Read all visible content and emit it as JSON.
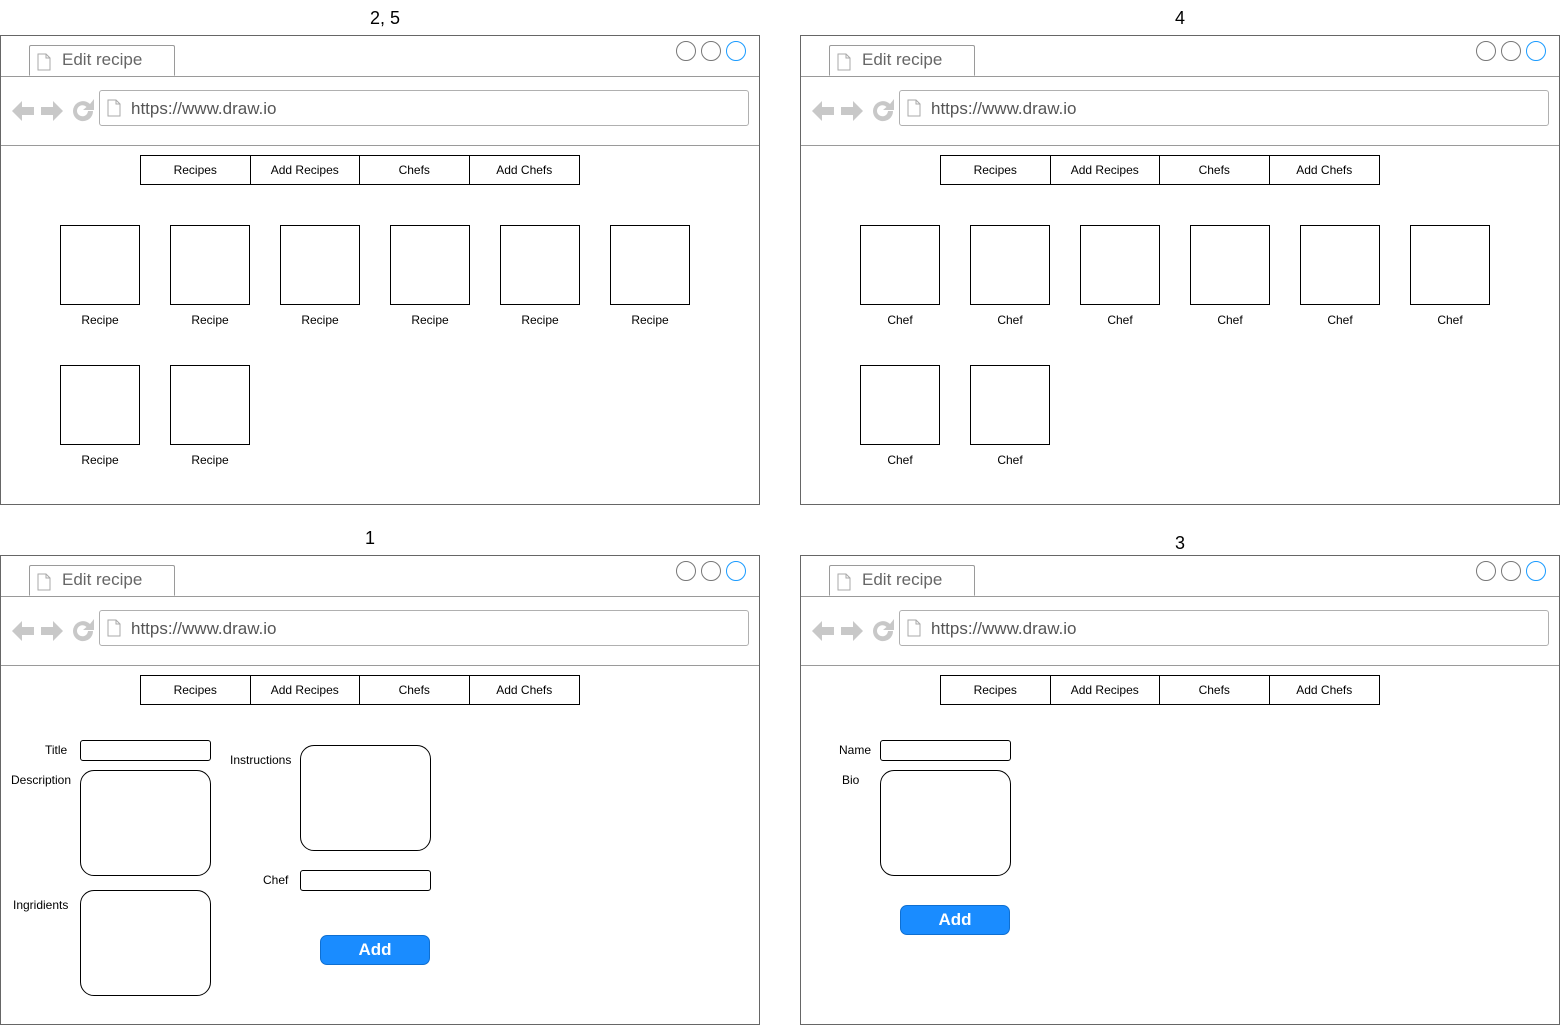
{
  "screen_labels": {
    "top_left": "2, 5",
    "top_right": "4",
    "bottom_left": "1",
    "bottom_right": "3"
  },
  "browser": {
    "tab_title": "Edit recipe",
    "url": "https://www.draw.io"
  },
  "menu": [
    "Recipes",
    "Add Recipes",
    "Chefs",
    "Add Chefs"
  ],
  "recipes_grid": {
    "item_label": "Recipe"
  },
  "chefs_grid": {
    "item_label": "Chef"
  },
  "add_recipe_form": {
    "title_label": "Title",
    "description_label": "Description",
    "ingredients_label": "Ingridients",
    "instructions_label": "Instructions",
    "chef_label": "Chef",
    "add_button": "Add"
  },
  "add_chef_form": {
    "name_label": "Name",
    "bio_label": "Bio",
    "add_button": "Add"
  },
  "colors": {
    "accent_button": "#1a8cff",
    "window_control_accent": "#1a9bff",
    "icon_grey": "#c8c8c8"
  }
}
